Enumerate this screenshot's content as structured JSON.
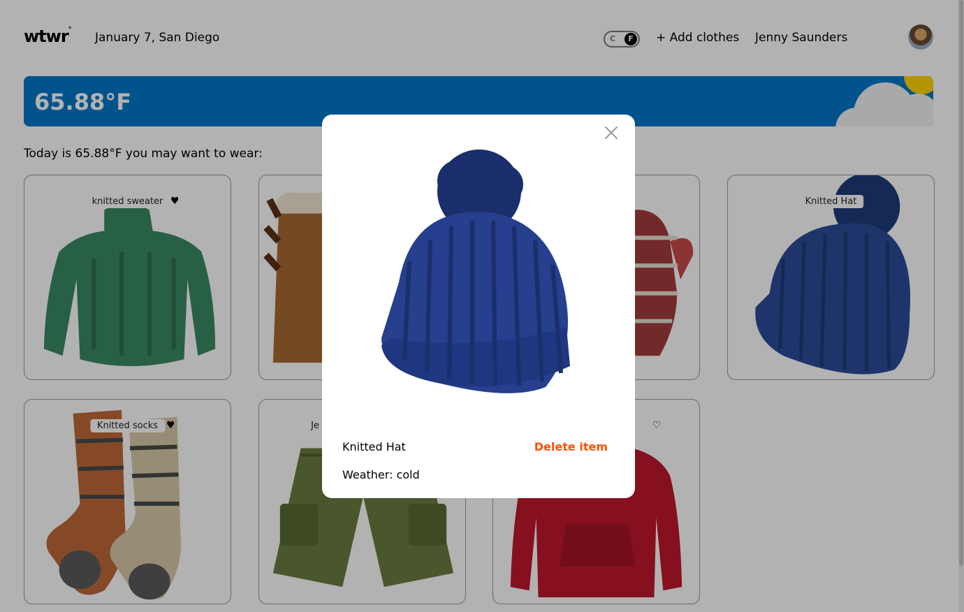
{
  "header": {
    "logo": "wtwr",
    "logo_mark": "°",
    "date_location": "January 7, San Diego",
    "toggle_c": "C",
    "toggle_f": "F",
    "add_clothes": "+ Add clothes",
    "user_name": "Jenny Saunders"
  },
  "weather": {
    "temperature": "65.88°F",
    "colors": {
      "sky": "#0077c8",
      "sun": "#ffd600",
      "cloud": "#f3f3f3"
    }
  },
  "main": {
    "today_text": "Today is 65.88°F you may want to wear:"
  },
  "cards": [
    {
      "label": "knitted sweater",
      "liked": true,
      "icon": "sweater"
    },
    {
      "label": "",
      "liked": false,
      "icon": "boot"
    },
    {
      "label": "",
      "liked": false,
      "icon": "mitten"
    },
    {
      "label": "Knitted Hat",
      "liked": false,
      "icon": "beanie"
    },
    {
      "label": "Knitted socks",
      "liked": true,
      "icon": "socks"
    },
    {
      "label": "Je",
      "liked": false,
      "icon": "cargo-shorts"
    },
    {
      "label": "",
      "liked": false,
      "icon": "hoodie"
    }
  ],
  "modal": {
    "item_name": "Knitted Hat",
    "delete_label": "Delete item",
    "weather_text": "Weather: cold",
    "accent": "#ff4f00"
  }
}
